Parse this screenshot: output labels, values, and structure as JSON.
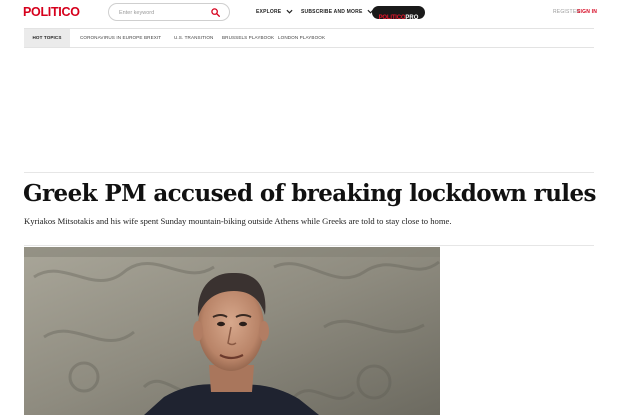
{
  "header": {
    "logo": "POLITICO",
    "search_placeholder": "Enter keyword",
    "explore_label": "EXPLORE",
    "subscribe_label": "SUBSCRIBE AND MORE",
    "pro_politico": "POLITICO",
    "pro_suffix": "PRO",
    "register_label": "REGISTER",
    "signin_label": "SIGN IN"
  },
  "topics": {
    "label": "HOT TOPICS",
    "items": [
      "CORONAVIRUS IN EUROPE",
      "BREXIT",
      "U.S. TRANSITION",
      "BRUSSELS PLAYBOOK",
      "LONDON PLAYBOOK"
    ]
  },
  "article": {
    "headline": "Greek PM accused of breaking lockdown rules",
    "dek": "Kyriakos Mitsotakis and his wife spent Sunday mountain-biking outside Athens while Greeks are told to stay close to home."
  },
  "colors": {
    "brand": "#d6001c",
    "pro_bg": "#1a1a1a"
  }
}
